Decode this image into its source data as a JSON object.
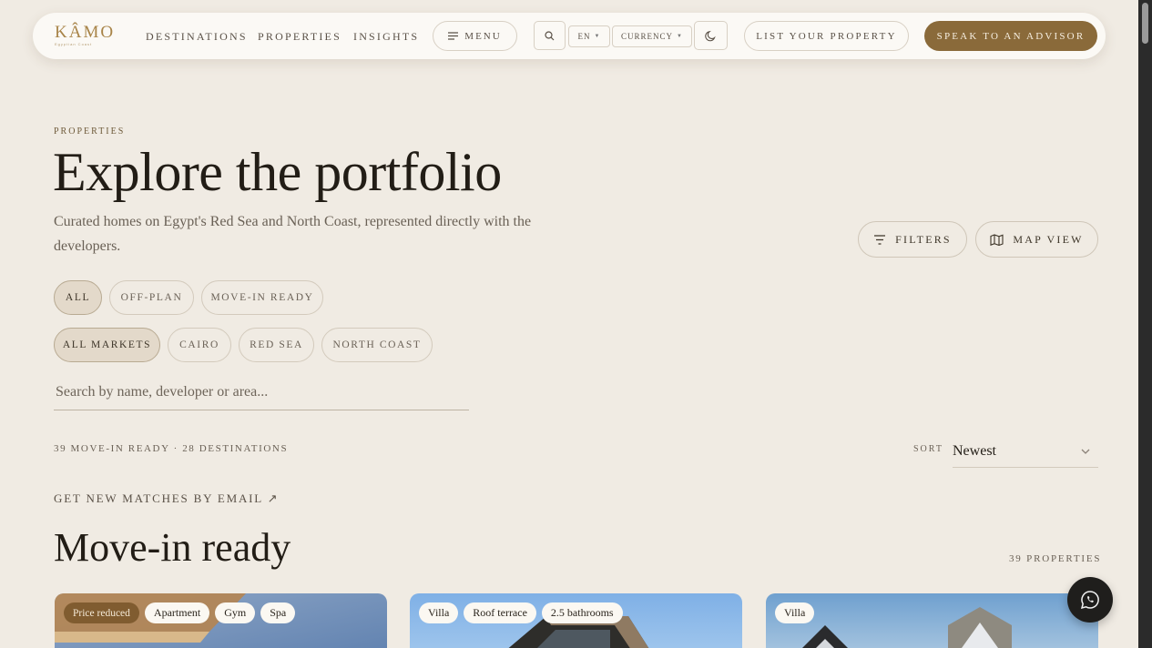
{
  "nav": {
    "logo": "KÂMO",
    "logo_sub": "Egyptian Coast",
    "links": [
      "DESTINATIONS",
      "PROPERTIES",
      "INSIGHTS"
    ],
    "menu_label": "MENU",
    "lang_label": "EN",
    "currency_label": "CURRENCY",
    "list_property_label": "LIST YOUR PROPERTY",
    "advisor_label": "SPEAK TO AN ADVISOR"
  },
  "hero": {
    "eyebrow": "PROPERTIES",
    "title": "Explore the portfolio",
    "subtitle": "Curated homes on Egypt's Red Sea and North Coast, represented directly with the developers.",
    "filters_label": "FILTERS",
    "map_view_label": "MAP VIEW"
  },
  "status_chips": [
    {
      "label": "ALL",
      "active": true
    },
    {
      "label": "OFF-PLAN",
      "active": false
    },
    {
      "label": "MOVE-IN READY",
      "active": false
    }
  ],
  "market_chips": [
    {
      "label": "ALL MARKETS",
      "active": true
    },
    {
      "label": "CAIRO",
      "active": false
    },
    {
      "label": "RED SEA",
      "active": false
    },
    {
      "label": "NORTH COAST",
      "active": false
    }
  ],
  "search": {
    "placeholder": "Search by name, developer or area..."
  },
  "results_meta": "39 MOVE-IN READY · 28 DESTINATIONS",
  "sort": {
    "label": "SORT",
    "value": "Newest"
  },
  "email_link": "GET NEW MATCHES BY EMAIL ↗",
  "section": {
    "title": "Move-in ready",
    "count": "39 PROPERTIES"
  },
  "cards": [
    {
      "tags": [
        "Price reduced",
        "Apartment",
        "Gym",
        "Spa"
      ]
    },
    {
      "tags": [
        "Villa",
        "Roof terrace",
        "2.5 bathrooms"
      ]
    },
    {
      "tags": [
        "Villa"
      ]
    }
  ],
  "colors": {
    "accent": "#8a6a3a",
    "background": "#f0ebe3",
    "logo": "#a88448"
  }
}
